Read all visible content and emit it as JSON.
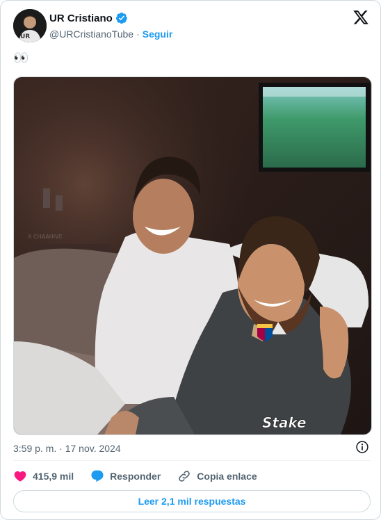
{
  "author": {
    "name": "UR Cristiano",
    "handle": "@URCristianoTube",
    "separator": "·",
    "follow_label": "Seguir"
  },
  "tweet": {
    "text": "👀",
    "media_watermark": "Stake",
    "timestamp": "3:59 p. m. · 17 nov. 2024"
  },
  "actions": {
    "likes": "415,9 mil",
    "reply_label": "Responder",
    "copy_link_label": "Copia enlace"
  },
  "replies_button": "Leer 2,1 mil respuestas",
  "colors": {
    "accent": "#1d9bf0",
    "like": "#f91880",
    "text_secondary": "#536471"
  }
}
